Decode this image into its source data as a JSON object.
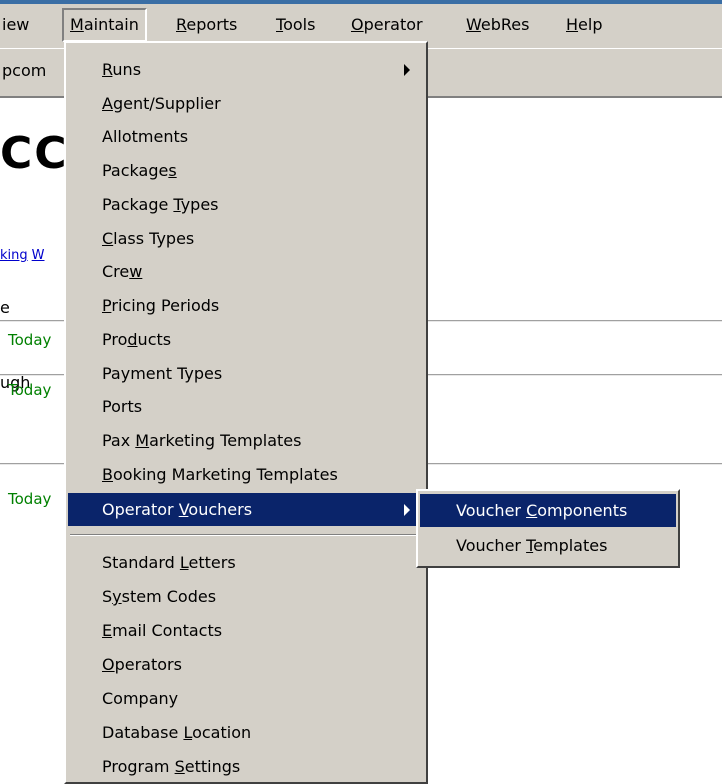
{
  "menubar": {
    "items": [
      {
        "label": "View",
        "mnemonic": "V",
        "shown": "iew"
      },
      {
        "label": "Maintain",
        "mnemonic": "M",
        "rest": "aintain"
      },
      {
        "label": "Reports",
        "mnemonic": "R",
        "rest": "eports"
      },
      {
        "label": "Tools",
        "mnemonic": "T",
        "rest": "ools"
      },
      {
        "label": "Operator",
        "mnemonic": "O",
        "rest": "perator"
      },
      {
        "label": "WebRes",
        "mnemonic": "W",
        "rest": "ebRes"
      },
      {
        "label": "Help",
        "mnemonic": "H",
        "rest": "elp"
      }
    ]
  },
  "toolbar": {
    "text": "pcom"
  },
  "background": {
    "title": "CC",
    "links": [
      "king",
      "W"
    ],
    "labels": [
      "e",
      "ugh"
    ],
    "today": [
      "Today",
      "Today",
      "Today"
    ]
  },
  "dropdown": {
    "items": [
      {
        "pre": "",
        "m": "R",
        "post": "uns",
        "submenu": true
      },
      {
        "pre": "",
        "m": "A",
        "post": "gent/Supplier"
      },
      {
        "pre": "Allotments",
        "m": "",
        "post": ""
      },
      {
        "pre": "Package",
        "m": "s",
        "post": ""
      },
      {
        "pre": "Package ",
        "m": "T",
        "post": "ypes"
      },
      {
        "pre": "",
        "m": "C",
        "post": "lass Types"
      },
      {
        "pre": "Cre",
        "m": "w",
        "post": ""
      },
      {
        "pre": "",
        "m": "P",
        "post": "ricing Periods"
      },
      {
        "pre": "Pro",
        "m": "d",
        "post": "ucts"
      },
      {
        "pre": "Payment Types",
        "m": "",
        "post": ""
      },
      {
        "pre": "Ports",
        "m": "",
        "post": ""
      },
      {
        "pre": "Pax ",
        "m": "M",
        "post": "arketing Templates"
      },
      {
        "pre": "",
        "m": "B",
        "post": "ooking Marketing Templates"
      },
      {
        "pre": "Operator ",
        "m": "V",
        "post": "ouchers",
        "submenu": true,
        "highlighted": true
      },
      {
        "pre": "Standard ",
        "m": "L",
        "post": "etters"
      },
      {
        "pre": "S",
        "m": "y",
        "post": "stem Codes"
      },
      {
        "pre": "",
        "m": "E",
        "post": "mail Contacts"
      },
      {
        "pre": "",
        "m": "O",
        "post": "perators"
      },
      {
        "pre": "Company",
        "m": "",
        "post": ""
      },
      {
        "pre": "Database ",
        "m": "L",
        "post": "ocation"
      },
      {
        "pre": "Program ",
        "m": "S",
        "post": "ettings"
      }
    ]
  },
  "submenu": {
    "items": [
      {
        "pre": "Voucher ",
        "m": "C",
        "post": "omponents",
        "highlighted": true
      },
      {
        "pre": "Voucher ",
        "m": "T",
        "post": "emplates"
      }
    ]
  },
  "colors": {
    "menu_face": "#d4d0c8",
    "highlight": "#0a246a",
    "link": "#0000cc",
    "today_green": "#008000"
  }
}
